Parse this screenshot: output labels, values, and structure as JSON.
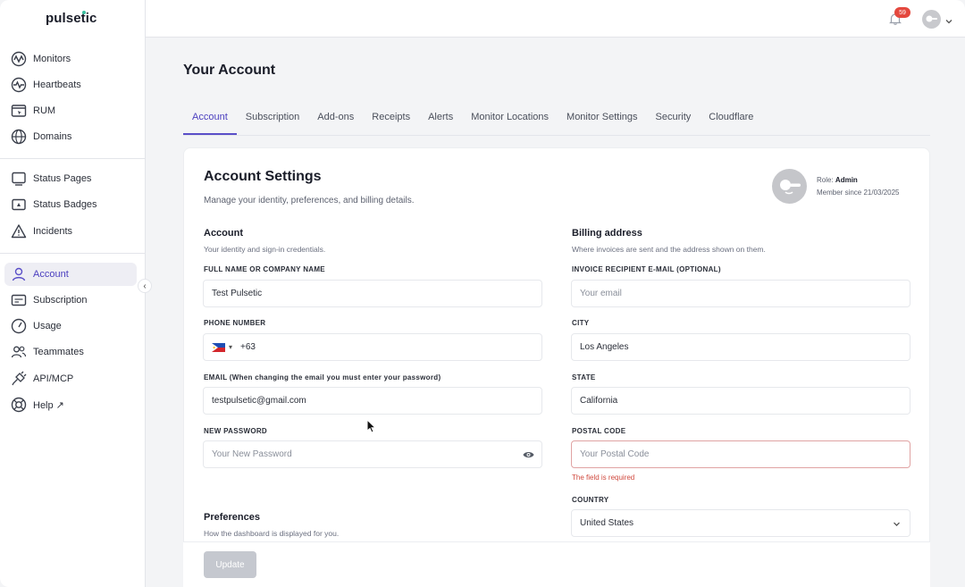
{
  "app": {
    "name": "pulsetic"
  },
  "sidebar": {
    "items": [
      {
        "label": "Monitors",
        "icon": "monitors-icon"
      },
      {
        "label": "Heartbeats",
        "icon": "heartbeats-icon"
      },
      {
        "label": "RUM",
        "icon": "rum-icon"
      },
      {
        "label": "Domains",
        "icon": "globe-icon"
      },
      {
        "label": "Status Pages",
        "icon": "status-pages-icon"
      },
      {
        "label": "Status Badges",
        "icon": "status-badges-icon"
      },
      {
        "label": "Incidents",
        "icon": "warning-icon"
      },
      {
        "label": "Account",
        "icon": "user-icon",
        "active": true
      },
      {
        "label": "Subscription",
        "icon": "subscription-icon"
      },
      {
        "label": "Usage",
        "icon": "gauge-icon"
      },
      {
        "label": "Teammates",
        "icon": "users-icon"
      },
      {
        "label": "API/MCP",
        "icon": "plug-icon"
      },
      {
        "label": "Help ↗",
        "icon": "help-icon"
      }
    ],
    "collapse_glyph": "‹"
  },
  "topbar": {
    "notification_count": "59",
    "bell_icon": "bell-icon",
    "avatar_icon": "avatar-icon"
  },
  "page": {
    "title": "Your Account",
    "tabs": [
      "Account",
      "Subscription",
      "Add-ons",
      "Receipts",
      "Alerts",
      "Monitor Locations",
      "Monitor Settings",
      "Security",
      "Cloudflare"
    ],
    "active_tab": "Account"
  },
  "card": {
    "title": "Account Settings",
    "subtitle": "Manage your identity, preferences, and billing details.",
    "role_label": "Role:",
    "role_value": "Admin",
    "member_since": "Member since 21/03/2025"
  },
  "account_section": {
    "title": "Account",
    "subtitle": "Your identity and sign-in credentials.",
    "full_name_label": "FULL NAME OR COMPANY NAME",
    "full_name_value": "Test Pulsetic",
    "phone_label": "PHONE NUMBER",
    "phone_code": "+63",
    "phone_caret": "▾",
    "email_label": "EMAIL (When changing the email you must enter your password)",
    "email_value": "testpulsetic@gmail.com",
    "password_label": "NEW PASSWORD",
    "password_placeholder": "Your New Password"
  },
  "preferences_section": {
    "title": "Preferences",
    "subtitle": "How the dashboard is displayed for you."
  },
  "billing_section": {
    "title": "Billing address",
    "subtitle": "Where invoices are sent and the address shown on them.",
    "invoice_email_label": "INVOICE RECIPIENT E-MAIL (OPTIONAL)",
    "invoice_email_placeholder": "Your email",
    "city_label": "CITY",
    "city_value": "Los Angeles",
    "state_label": "STATE",
    "state_value": "California",
    "postal_label": "POSTAL CODE",
    "postal_placeholder": "Your Postal Code",
    "postal_error": "The field is required",
    "country_label": "COUNTRY",
    "country_value": "United States"
  },
  "actions": {
    "update_label": "Update"
  },
  "colors": {
    "accent": "#5a4fc8",
    "error": "#d04a3f",
    "badge": "#e4483e"
  }
}
